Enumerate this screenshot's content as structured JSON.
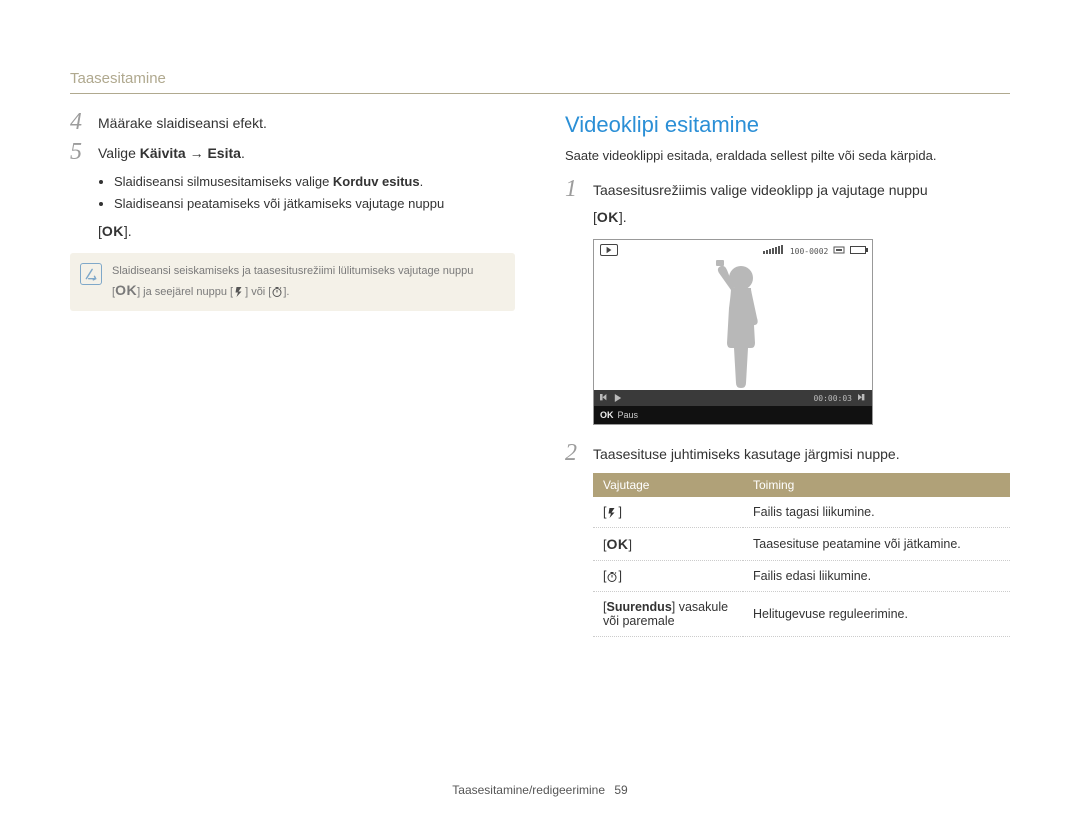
{
  "header": {
    "section": "Taasesitamine"
  },
  "left": {
    "step4_num": "4",
    "step4_text": "Määrake slaidiseansi efekt.",
    "step5_num": "5",
    "step5_label": "Valige ",
    "step5_bold": "Käivita → Esita",
    "step5_after": ".",
    "bullet1_a": "Slaidiseansi silmusesitamiseks valige ",
    "bullet1_b": "Korduv esitus",
    "bullet1_c": ".",
    "bullet2": "Slaidiseansi peatamiseks või jätkamiseks vajutage nuppu",
    "ok_after": "].",
    "note_a": "Slaidiseansi seiskamiseks ja taasesitusrežiimi lülitumiseks vajutage nuppu [",
    "note_b": "] ja seejärel nuppu [",
    "note_c": "] või [",
    "note_d": "]."
  },
  "right": {
    "heading": "Videoklipi esitamine",
    "intro": "Saate videoklippi esitada, eraldada sellest pilte või seda kärpida.",
    "step1_num": "1",
    "step1_text": "Taasesitusrežiimis valige videoklipp ja vajutage nuppu",
    "step1_after": "].",
    "step2_num": "2",
    "step2_text": "Taasesituse juhtimiseks kasutage järgmisi nuppe.",
    "fig": {
      "counter": "100-0002",
      "time": "00:00:03",
      "paus_label": "Paus",
      "ok": "OK"
    },
    "table": {
      "th1": "Vajutage",
      "th2": "Toiming",
      "rows": [
        {
          "key_type": "flash",
          "action": "Failis tagasi liikumine."
        },
        {
          "key_type": "ok",
          "action": "Taasesituse peatamine või jätkamine."
        },
        {
          "key_type": "timer",
          "action": "Failis edasi liikumine."
        },
        {
          "key_type": "zoom_text",
          "key_text_a": "[",
          "key_text_b": "Suurendus",
          "key_text_c": "] vasakule või paremale",
          "action": "Helitugevuse reguleerimine."
        }
      ]
    }
  },
  "footer": {
    "text": "Taasesitamine/redigeerimine",
    "page": "59"
  }
}
